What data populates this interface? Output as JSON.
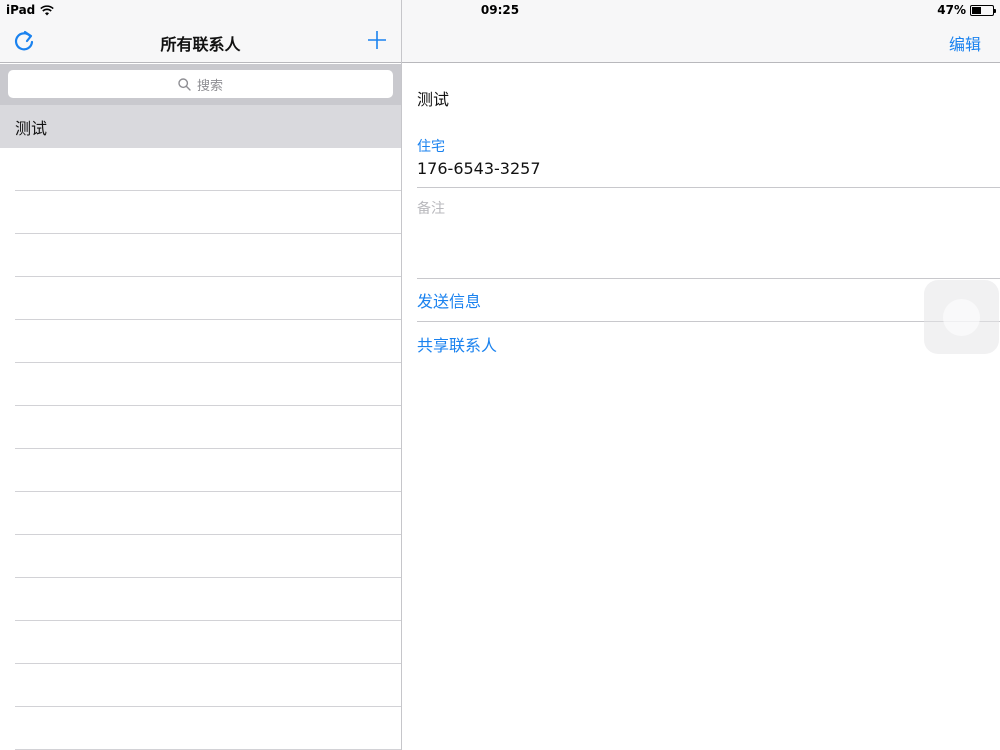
{
  "status_bar": {
    "carrier": "iPad",
    "time": "09:25",
    "battery_percent": "47%",
    "battery_level": 0.47
  },
  "master": {
    "title": "所有联系人",
    "search_placeholder": "搜索",
    "contacts": [
      "测试"
    ],
    "empty_rows": 14
  },
  "detail": {
    "edit_label": "编辑",
    "name": "测试",
    "phone_label": "住宅",
    "phone_value": "176-6543-3257",
    "notes_label": "备注",
    "send_message": "发送信息",
    "share_contact": "共享联系人"
  },
  "colors": {
    "accent": "#1a82ef",
    "nav_bg": "#f7f7f8",
    "search_bg": "#c9c9ce",
    "selected_row": "#d9d9dd"
  },
  "icons": {
    "refresh": "refresh-icon",
    "add": "plus-icon",
    "search": "search-icon",
    "wifi": "wifi-icon",
    "battery": "battery-icon"
  }
}
